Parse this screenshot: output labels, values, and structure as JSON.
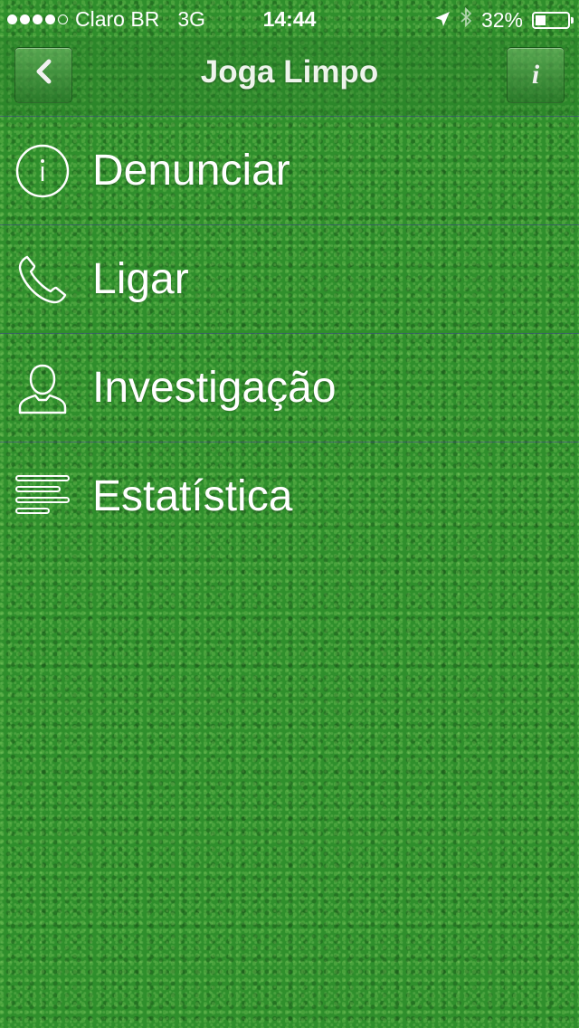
{
  "status_bar": {
    "carrier": "Claro BR",
    "network": "3G",
    "time": "14:44",
    "battery_percent": "32%",
    "battery_level": 0.32
  },
  "nav": {
    "title": "Joga Limpo",
    "back_icon": "chevron-left-icon",
    "info_icon": "info-icon",
    "info_glyph": "i"
  },
  "menu": {
    "items": [
      {
        "label": "Denunciar",
        "icon": "info-circle-icon"
      },
      {
        "label": "Ligar",
        "icon": "phone-icon"
      },
      {
        "label": "Investigação",
        "icon": "person-icon"
      },
      {
        "label": "Estatística",
        "icon": "bars-icon"
      }
    ]
  },
  "colors": {
    "background_grass": "#2f8f2c",
    "text": "#ffffff",
    "divider": "#3c3c8c"
  }
}
